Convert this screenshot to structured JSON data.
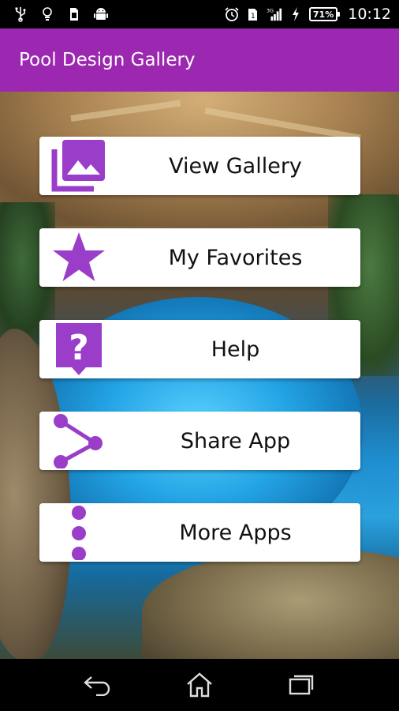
{
  "status_bar": {
    "time": "10:12",
    "battery": "71%",
    "icons": [
      "usb-icon",
      "bulb-icon",
      "sim-icon",
      "android-icon",
      "alarm-icon",
      "sim-1-icon",
      "signal-3g-icon",
      "charging-icon",
      "battery-icon"
    ]
  },
  "app_bar": {
    "title": "Pool Design Gallery",
    "color": "#9c27b0"
  },
  "menu": {
    "accent": "#9a3dc9",
    "items": [
      {
        "label": "View Gallery",
        "icon": "gallery-icon"
      },
      {
        "label": "My Favorites",
        "icon": "star-icon"
      },
      {
        "label": "Help",
        "icon": "help-icon"
      },
      {
        "label": "Share App",
        "icon": "share-icon"
      },
      {
        "label": "More Apps",
        "icon": "more-vert-icon"
      }
    ]
  },
  "nav_bar": {
    "buttons": [
      "back-icon",
      "home-icon",
      "recents-icon"
    ]
  }
}
